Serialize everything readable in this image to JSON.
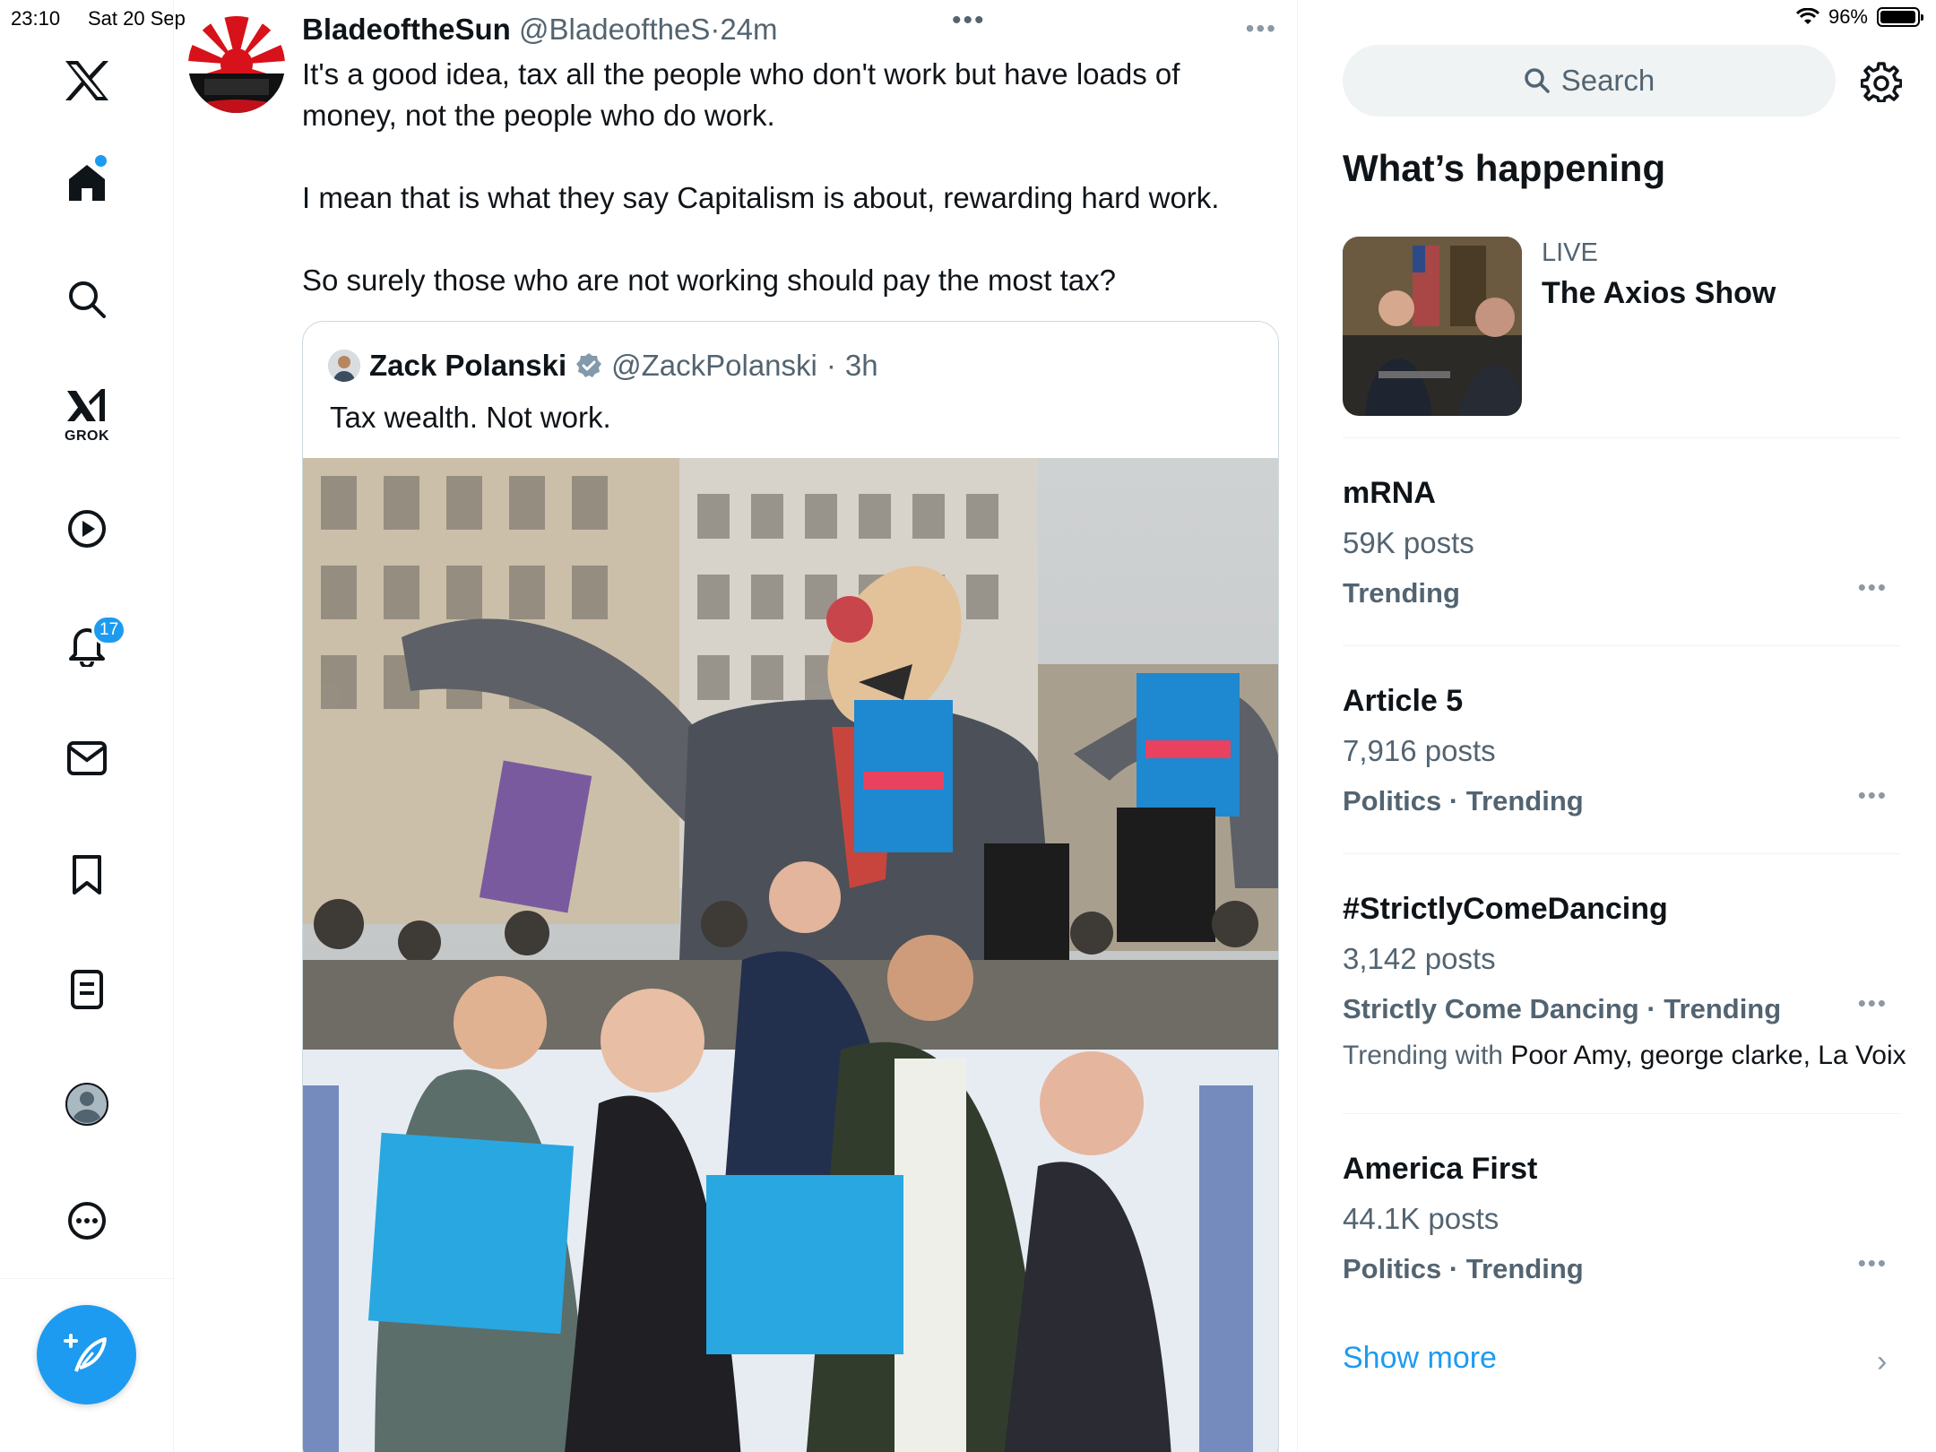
{
  "status_bar": {
    "time": "23:10",
    "date": "Sat 20 Sep",
    "battery": "96%",
    "battery_level": 0.96
  },
  "sidebar": {
    "items": [
      {
        "id": "x-logo",
        "icon": "x-logo-icon"
      },
      {
        "id": "home",
        "icon": "home-icon",
        "has_new_dot": true
      },
      {
        "id": "explore",
        "icon": "search-icon"
      },
      {
        "id": "grok",
        "icon": "grok-icon",
        "label": "GROK"
      },
      {
        "id": "videos",
        "icon": "play-icon"
      },
      {
        "id": "notifications",
        "icon": "bell-icon",
        "badge": "17"
      },
      {
        "id": "messages",
        "icon": "mail-icon"
      },
      {
        "id": "bookmarks",
        "icon": "bookmark-icon"
      },
      {
        "id": "lists",
        "icon": "list-icon"
      },
      {
        "id": "profile",
        "icon": "avatar-icon"
      },
      {
        "id": "more",
        "icon": "more-circle-icon"
      }
    ],
    "compose_icon": "compose-feather-icon"
  },
  "tweet": {
    "author_name": "BladeoftheSun",
    "author_handle": "@BladeoftheS",
    "separator": "·",
    "time": "24m",
    "paragraphs": [
      "It's a good idea, tax all the people who don't work but have loads of money, not the people who do work.",
      "I mean that is what they say Capitalism is about, rewarding hard work.",
      "So surely those who are not working should pay the most tax?"
    ],
    "quoted": {
      "author_name": "Zack Polanski",
      "verified": true,
      "author_handle": "@ZackPolanski",
      "separator": "·",
      "time": "3h",
      "text": "Tax wealth. Not work."
    }
  },
  "right_panel": {
    "search_placeholder": "Search",
    "section_title": "What’s happening",
    "live": {
      "label": "LIVE",
      "title": "The Axios Show"
    },
    "trends": [
      {
        "name": "mRNA",
        "count": "59K posts",
        "meta": "Trending"
      },
      {
        "name": "Article 5",
        "count": "7,916 posts",
        "meta": "Politics · Trending"
      },
      {
        "name": "#StrictlyComeDancing",
        "count": "3,142 posts",
        "meta": "Strictly Come Dancing · Trending",
        "with_label": "Trending with ",
        "with_names": "Poor Amy, george clarke, La Voix"
      },
      {
        "name": "America First",
        "count": "44.1K posts",
        "meta": "Politics · Trending"
      }
    ],
    "show_more": "Show more"
  },
  "colors": {
    "accent": "#1d9bf0",
    "text_primary": "#0f1419",
    "text_secondary": "#536471",
    "divider": "#eff3f4"
  }
}
